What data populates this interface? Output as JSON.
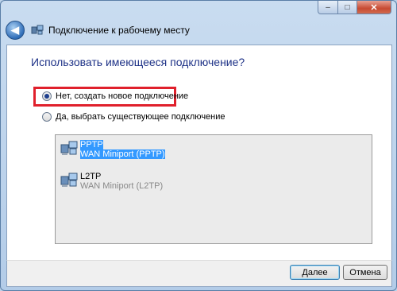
{
  "window": {
    "title": "Подключение к рабочему месту",
    "caption_min": "–",
    "caption_max": "□",
    "caption_close": "✕"
  },
  "heading": "Использовать имеющееся подключение?",
  "options": [
    {
      "label": "Нет, создать новое подключение",
      "checked": true
    },
    {
      "label": "Да, выбрать существующее подключение",
      "checked": false
    }
  ],
  "connections": [
    {
      "name": "PPTP",
      "type": "WAN Miniport (PPTP)",
      "selected": true
    },
    {
      "name": "L2TP",
      "type": "WAN Miniport (L2TP)",
      "selected": false
    }
  ],
  "buttons": {
    "next": "Далее",
    "cancel": "Отмена"
  },
  "colors": {
    "highlight": "#e0202c",
    "heading": "#1e3287",
    "selection": "#3399ff"
  }
}
